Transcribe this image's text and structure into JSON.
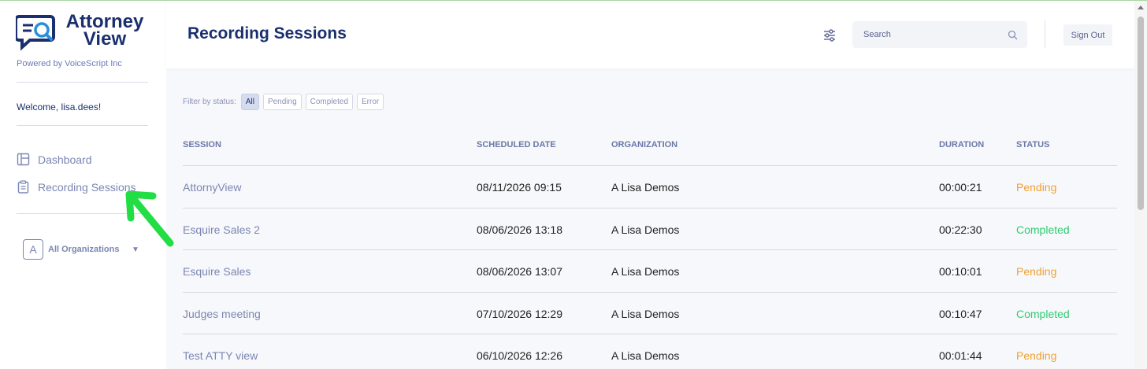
{
  "brand": {
    "name_line1": "Attorney",
    "name_line2": "View",
    "powered_by": "Powered by VoiceScript Inc"
  },
  "sidebar": {
    "welcome": "Welcome, lisa.dees!",
    "items": [
      {
        "label": "Dashboard",
        "icon": "dashboard-icon"
      },
      {
        "label": "Recording Sessions",
        "icon": "clipboard-icon"
      }
    ],
    "org": {
      "avatar_letter": "A",
      "label": "All Organizations",
      "caret": "▼"
    }
  },
  "header": {
    "title": "Recording Sessions",
    "search_placeholder": "Search",
    "sign_out": "Sign Out"
  },
  "filter": {
    "label": "Filter by status:",
    "options": [
      "All",
      "Pending",
      "Completed",
      "Error"
    ],
    "selected": "All"
  },
  "table": {
    "columns": [
      "SESSION",
      "SCHEDULED DATE",
      "ORGANIZATION",
      "DURATION",
      "STATUS"
    ],
    "rows": [
      {
        "session": "AttornyView",
        "date": "08/11/2026 09:15",
        "org": "A Lisa Demos",
        "duration": "00:00:21",
        "status": "Pending"
      },
      {
        "session": "Esquire Sales 2",
        "date": "08/06/2026 13:18",
        "org": "A Lisa Demos",
        "duration": "00:22:30",
        "status": "Completed"
      },
      {
        "session": "Esquire Sales",
        "date": "08/06/2026 13:07",
        "org": "A Lisa Demos",
        "duration": "00:10:01",
        "status": "Pending"
      },
      {
        "session": "Judges meeting",
        "date": "07/10/2026 12:29",
        "org": "A Lisa Demos",
        "duration": "00:10:47",
        "status": "Completed"
      },
      {
        "session": "Test ATTY view",
        "date": "06/10/2026 12:26",
        "org": "A Lisa Demos",
        "duration": "00:01:44",
        "status": "Pending"
      }
    ]
  },
  "colors": {
    "brand": "#1a2f6e",
    "pending": "#f0a032",
    "completed": "#2ecc71",
    "annotation_arrow": "#22dd44"
  }
}
